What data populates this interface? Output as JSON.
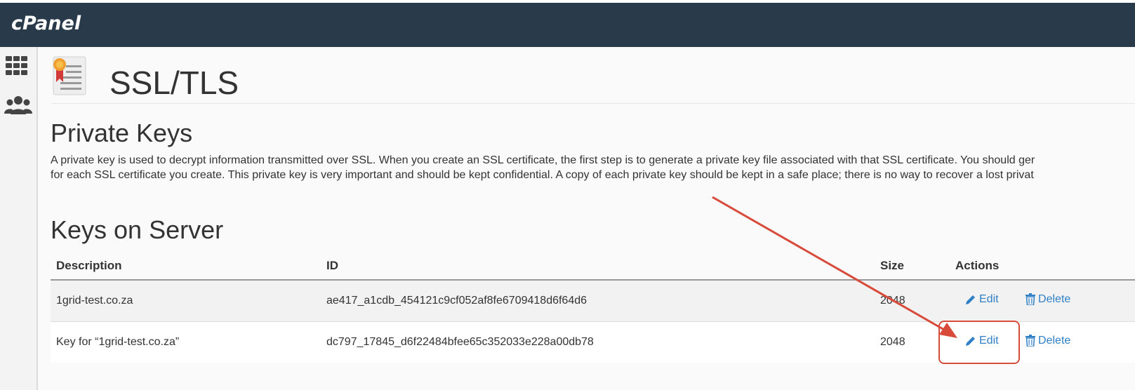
{
  "app": {
    "logo": "cPanel"
  },
  "sidebar": {
    "items": [
      {
        "icon": "grid-icon"
      },
      {
        "icon": "users-icon"
      }
    ]
  },
  "page": {
    "title": "SSL/TLS",
    "icon": "certificate-icon"
  },
  "private_keys": {
    "title": "Private Keys",
    "description_line1": "A private key is used to decrypt information transmitted over SSL. When you create an SSL certificate, the first step is to generate a private key file associated with that SSL certificate. You should ger",
    "description_line2": "for each SSL certificate you create. This private key is very important and should be kept confidential. A copy of each private key should be kept in a safe place; there is no way to recover a lost privat"
  },
  "keys_on_server": {
    "title": "Keys on Server",
    "columns": [
      "Description",
      "ID",
      "Size",
      "Actions"
    ],
    "rows": [
      {
        "description": "1grid-test.co.za",
        "id": "ae417_a1cdb_454121c9cf052af8fe6709418d6f64d6",
        "size": "2048",
        "edit_label": "Edit",
        "delete_label": "Delete"
      },
      {
        "description": "Key for “1grid-test.co.za”",
        "id": "dc797_17845_d6f22484bfee65c352033e228a00db78",
        "size": "2048",
        "edit_label": "Edit",
        "delete_label": "Delete"
      }
    ]
  },
  "colors": {
    "topbar": "#293a4a",
    "link": "#2f7fc6",
    "annotation": "#d84a3a"
  }
}
